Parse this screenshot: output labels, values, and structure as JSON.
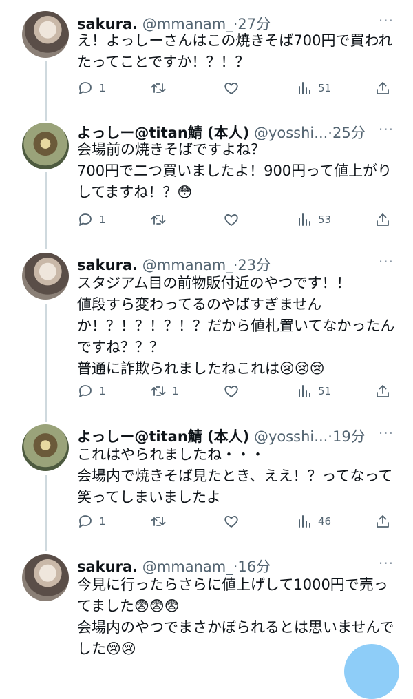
{
  "tweets": [
    {
      "name": "sakura.",
      "handle": "@mmanam_",
      "time": "·27分",
      "text": "え！よっしーさんはこの焼きそば700円で買われたってことですか！？！？",
      "avatar": "sakura-avatar",
      "replies": "1",
      "retweets": "",
      "likes": "",
      "views": "51"
    },
    {
      "name": "よっしー@titan鯖 (本人)",
      "handle": "@yosshi...",
      "time": "·25分",
      "text": "会場前の焼きそばですよね？\n700円で二つ買いましたよ！900円って値上がりしてますね！？😳",
      "avatar": "yoshi-avatar",
      "replies": "1",
      "retweets": "",
      "likes": "",
      "views": "53"
    },
    {
      "name": "sakura.",
      "handle": "@mmanam_",
      "time": "·23分",
      "text": "スタジアム目の前物販付近のやつです！！\n値段すら変わってるのやばすぎませんか！？！？！？！？だから値札置いてなかったんですね？？？\n普通に詐欺られましたねこれは😢😢😢",
      "avatar": "sakura-avatar",
      "replies": "1",
      "retweets": "1",
      "likes": "",
      "views": "51"
    },
    {
      "name": "よっしー@titan鯖 (本人)",
      "handle": "@yosshi...",
      "time": "·19分",
      "text": "これはやられましたね・・・\n会場内で焼きそば見たとき、ええ！？ってなって笑ってしまいましたよ",
      "avatar": "yoshi-avatar",
      "replies": "1",
      "retweets": "",
      "likes": "",
      "views": "46"
    },
    {
      "name": "sakura.",
      "handle": "@mmanam_",
      "time": "·16分",
      "text": "今見に行ったらさらに値上げして1000円で売ってました😨😨😨\n会場内のやつでまさかぼられるとは思いませんでした😢😢",
      "avatar": "sakura-avatar",
      "replies": "",
      "retweets": "",
      "likes": "",
      "views": ""
    }
  ],
  "more_label": "···",
  "colors": {
    "text": "#0f1419",
    "muted": "#536471",
    "line": "#cfd9de",
    "fab": "#8ecdf8"
  }
}
